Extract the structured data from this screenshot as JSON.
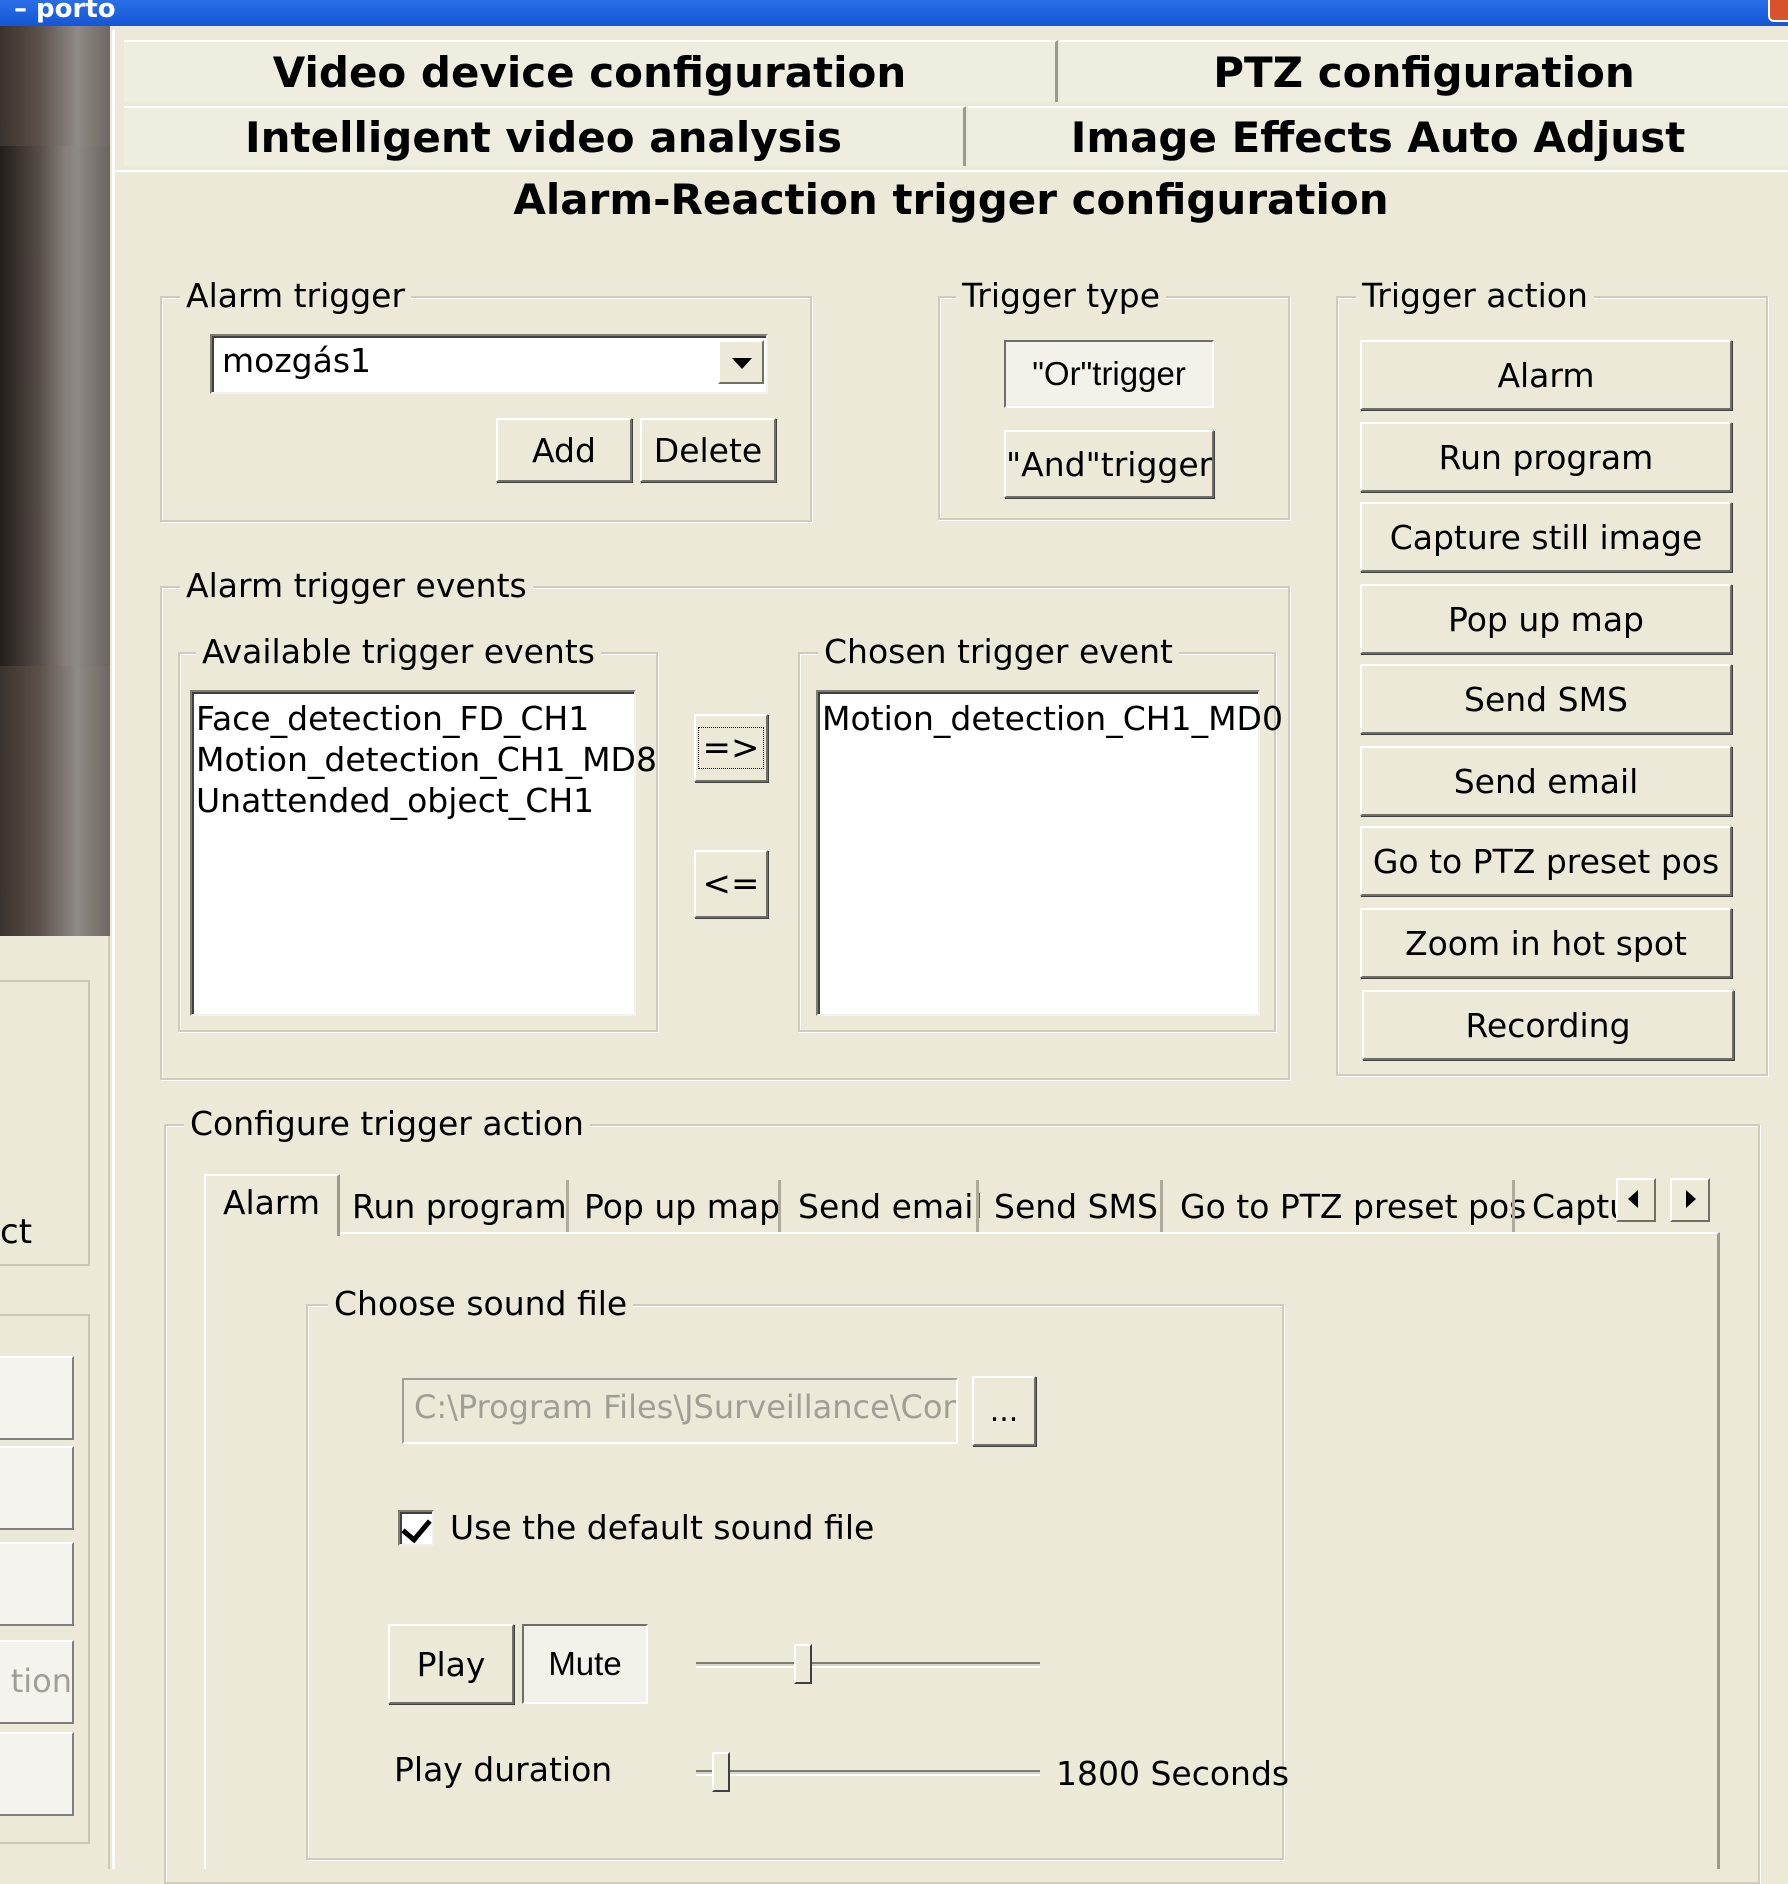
{
  "window": {
    "title": "– porto"
  },
  "left_panel": {
    "partial_text_1": "ct",
    "partial_text_2": "tion"
  },
  "main_tabs": {
    "row1": [
      "Video device configuration",
      "PTZ configuration"
    ],
    "row2": [
      "Intelligent video analysis",
      "Image Effects Auto Adjust"
    ],
    "active": "Alarm-Reaction trigger configuration"
  },
  "alarm_trigger": {
    "legend": "Alarm trigger",
    "selected": "mozgás1",
    "add_label": "Add",
    "delete_label": "Delete"
  },
  "trigger_type": {
    "legend": "Trigger type",
    "or_label": "\"Or\"trigger",
    "and_label": "\"And\"trigger"
  },
  "trigger_action": {
    "legend": "Trigger action",
    "buttons": [
      "Alarm",
      "Run program",
      "Capture still image",
      "Pop up map",
      "Send SMS",
      "Send email",
      "Go to PTZ preset pos",
      "Zoom in hot spot",
      "Recording"
    ]
  },
  "alarm_trigger_events": {
    "legend": "Alarm trigger events",
    "available_legend": "Available trigger events",
    "available": [
      "Face_detection_FD_CH1",
      "Motion_detection_CH1_MD8",
      "Unattended_object_CH1"
    ],
    "chosen_legend": "Chosen trigger event",
    "chosen": [
      "Motion_detection_CH1_MD0"
    ],
    "move_right_label": "=>",
    "move_left_label": "<="
  },
  "configure_action": {
    "legend": "Configure trigger action",
    "tabs": [
      "Alarm",
      "Run program",
      "Pop up map",
      "Send email",
      "Send SMS",
      "Go to PTZ preset pos",
      "Captu"
    ],
    "active_tab": "Alarm",
    "sound": {
      "legend": "Choose sound file",
      "path": "C:\\Program Files\\JSurveillance\\Conf",
      "browse_label": "...",
      "use_default_label": "Use the default sound file",
      "use_default_checked": true,
      "play_label": "Play",
      "mute_label": "Mute",
      "volume_level": 0.3,
      "duration_label": "Play duration",
      "duration_value": "1800 Seconds",
      "duration_level": 0.05
    }
  }
}
